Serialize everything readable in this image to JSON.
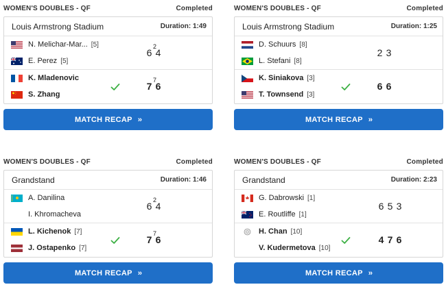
{
  "matches": [
    {
      "round": "WOMEN'S DOUBLES - QF",
      "status": "Completed",
      "venue": "Louis Armstrong Stadium",
      "duration": "Duration: 1:49",
      "recap_label": "MATCH RECAP",
      "teams": [
        {
          "winner": false,
          "players": [
            {
              "name": "N. Melichar-Mar...",
              "seed": "[5]",
              "flag": "usa-flag"
            },
            {
              "name": "E. Perez",
              "seed": "[5]",
              "flag": "australia-flag"
            }
          ],
          "scores": [
            {
              "v": "6",
              "tb": "2"
            },
            {
              "v": "4",
              "tb": ""
            }
          ]
        },
        {
          "winner": true,
          "players": [
            {
              "name": "K. Mladenovic",
              "seed": "",
              "flag": "france-flag"
            },
            {
              "name": "S. Zhang",
              "seed": "",
              "flag": "china-flag"
            }
          ],
          "scores": [
            {
              "v": "7",
              "tb": "7"
            },
            {
              "v": "6",
              "tb": ""
            }
          ]
        }
      ]
    },
    {
      "round": "WOMEN'S DOUBLES - QF",
      "status": "Completed",
      "venue": "Louis Armstrong Stadium",
      "duration": "Duration: 1:25",
      "recap_label": "MATCH RECAP",
      "teams": [
        {
          "winner": false,
          "players": [
            {
              "name": "D. Schuurs",
              "seed": "[8]",
              "flag": "netherlands-flag"
            },
            {
              "name": "L. Stefani",
              "seed": "[8]",
              "flag": "brazil-flag"
            }
          ],
          "scores": [
            {
              "v": "2",
              "tb": ""
            },
            {
              "v": "3",
              "tb": ""
            }
          ]
        },
        {
          "winner": true,
          "players": [
            {
              "name": "K. Siniakova",
              "seed": "[3]",
              "flag": "czech-flag"
            },
            {
              "name": "T. Townsend",
              "seed": "[3]",
              "flag": "usa-flag"
            }
          ],
          "scores": [
            {
              "v": "6",
              "tb": ""
            },
            {
              "v": "6",
              "tb": ""
            }
          ]
        }
      ]
    },
    {
      "round": "WOMEN'S DOUBLES - QF",
      "status": "Completed",
      "venue": "Grandstand",
      "duration": "Duration: 1:46",
      "recap_label": "MATCH RECAP",
      "teams": [
        {
          "winner": false,
          "players": [
            {
              "name": "A. Danilina",
              "seed": "",
              "flag": "kazakhstan-flag"
            },
            {
              "name": "I. Khromacheva",
              "seed": "",
              "flag": ""
            }
          ],
          "scores": [
            {
              "v": "6",
              "tb": "2"
            },
            {
              "v": "4",
              "tb": ""
            }
          ]
        },
        {
          "winner": true,
          "players": [
            {
              "name": "L. Kichenok",
              "seed": "[7]",
              "flag": "ukraine-flag"
            },
            {
              "name": "J. Ostapenko",
              "seed": "[7]",
              "flag": "latvia-flag"
            }
          ],
          "scores": [
            {
              "v": "7",
              "tb": "7"
            },
            {
              "v": "6",
              "tb": ""
            }
          ]
        }
      ]
    },
    {
      "round": "WOMEN'S DOUBLES - QF",
      "status": "Completed",
      "venue": "Grandstand",
      "duration": "Duration: 2:23",
      "recap_label": "MATCH RECAP",
      "teams": [
        {
          "winner": false,
          "players": [
            {
              "name": "G. Dabrowski",
              "seed": "[1]",
              "flag": "canada-flag"
            },
            {
              "name": "E. Routliffe",
              "seed": "[1]",
              "flag": "new-zealand-flag"
            }
          ],
          "scores": [
            {
              "v": "6",
              "tb": ""
            },
            {
              "v": "5",
              "tb": ""
            },
            {
              "v": "3",
              "tb": ""
            }
          ]
        },
        {
          "winner": true,
          "players": [
            {
              "name": "H. Chan",
              "seed": "[10]",
              "flag": "neutral-flag"
            },
            {
              "name": "V. Kudermetova",
              "seed": "[10]",
              "flag": ""
            }
          ],
          "scores": [
            {
              "v": "4",
              "tb": ""
            },
            {
              "v": "7",
              "tb": ""
            },
            {
              "v": "6",
              "tb": ""
            }
          ]
        }
      ]
    }
  ],
  "colors": {
    "accent": "#1f6fc8",
    "check": "#3cb043",
    "border": "#d6d6d6"
  }
}
